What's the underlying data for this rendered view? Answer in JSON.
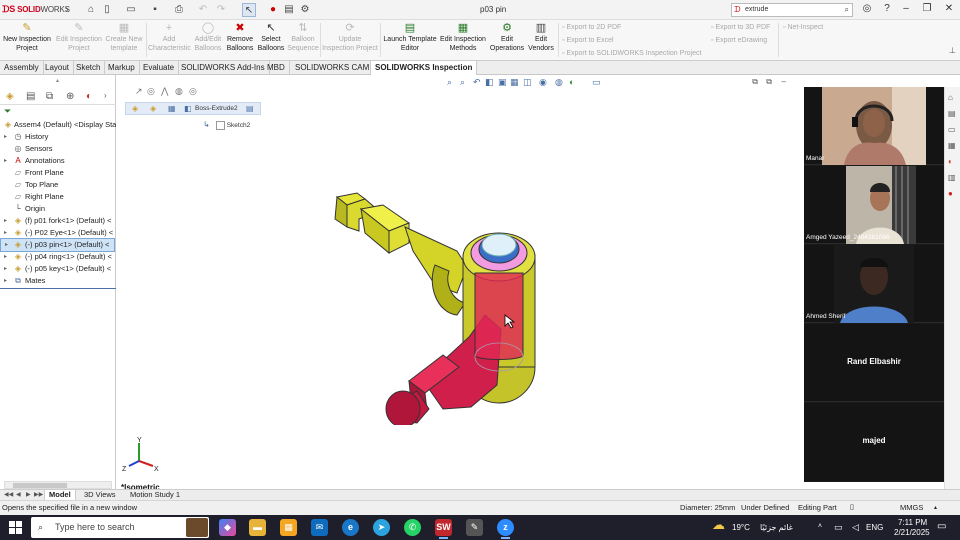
{
  "app": {
    "logo_brand": "SOLID",
    "logo_rest": "WORKS",
    "document_title": "p03 pin",
    "search_value": "extrude"
  },
  "ribbon": {
    "buttons": [
      {
        "label": "New Inspection Project",
        "enabled": true
      },
      {
        "label": "Edit Inspection Project",
        "enabled": false
      },
      {
        "label": "Create New template",
        "enabled": false
      },
      {
        "label": "Add Characteristic",
        "enabled": false
      },
      {
        "label": "Add/Edit Balloons",
        "enabled": false
      },
      {
        "label": "Remove Balloons",
        "enabled": true
      },
      {
        "label": "Select Balloons",
        "enabled": true
      },
      {
        "label": "Balloon Sequence",
        "enabled": false
      },
      {
        "label": "Update Inspection Project",
        "enabled": false
      },
      {
        "label": "Launch Template Editor",
        "enabled": true
      },
      {
        "label": "Edit Inspection Methods",
        "enabled": true
      },
      {
        "label": "Edit Operations",
        "enabled": true
      },
      {
        "label": "Edit Vendors",
        "enabled": true
      }
    ],
    "export_list": [
      "Export to 2D PDF",
      "Export to Excel",
      "Export to SOLIDWORKS Inspection Project"
    ],
    "export_list2": [
      "Export to 3D PDF",
      "Export eDrawing"
    ],
    "net_inspect": "Net-Inspect"
  },
  "tabs": [
    "Assembly",
    "Layout",
    "Sketch",
    "Markup",
    "Evaluate",
    "SOLIDWORKS Add-Ins",
    "MBD",
    "SOLIDWORKS CAM",
    "SOLIDWORKS Inspection"
  ],
  "active_tab": "SOLIDWORKS Inspection",
  "tree": {
    "root": "Assem4 (Default) <Display Sta",
    "items": [
      {
        "label": "History"
      },
      {
        "label": "Sensors"
      },
      {
        "label": "Annotations"
      },
      {
        "label": "Front Plane"
      },
      {
        "label": "Top Plane"
      },
      {
        "label": "Right Plane"
      },
      {
        "label": "Origin"
      },
      {
        "label": "(f) p01 fork<1> (Default) <"
      },
      {
        "label": "(-) P02 Eye<1> (Default) <"
      },
      {
        "label": "(-) p03 pin<1> (Default) <"
      },
      {
        "label": "(-) p04 ring<1> (Default) <"
      },
      {
        "label": "(-) p05 key<1> (Default) <"
      },
      {
        "label": "Mates"
      }
    ]
  },
  "viewport": {
    "breadcrumb_label": "Boss-Extrude2",
    "sketch_label": "Sketch2",
    "view_label": "*Isometric",
    "axis_x": "X",
    "axis_y": "Y",
    "axis_z": "Z"
  },
  "meeting": {
    "participants": [
      "Manar",
      "Amged Yazeed_2404261086",
      "Ahmed Sherif",
      "Rand Elbashir",
      "majed"
    ]
  },
  "bottom_tabs": [
    "Model",
    "3D Views",
    "Motion Study 1"
  ],
  "active_bottom_tab": "Model",
  "status": {
    "message": "Opens the specified file in a new window",
    "diameter": "Diameter: 25mm",
    "definition": "Under Defined",
    "mode": "Editing Part",
    "units": "MMGS"
  },
  "taskbar": {
    "search_placeholder": "Type here to search",
    "weather": "19°C",
    "weather_text": "غائم جزئيًا",
    "lang": "ENG",
    "time": "7:11 PM",
    "date": "2/21/2025"
  }
}
